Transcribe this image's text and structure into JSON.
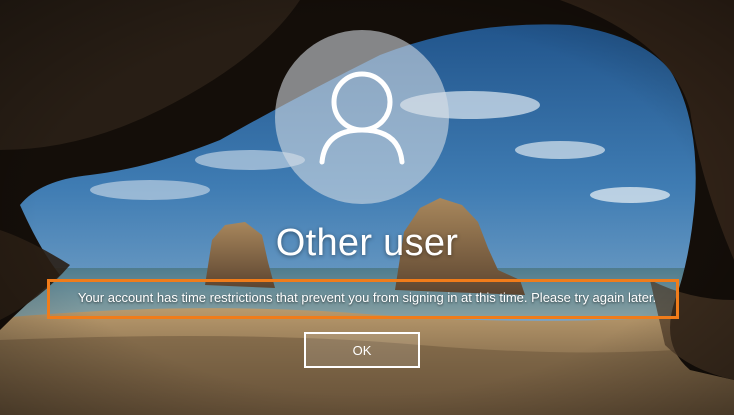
{
  "lock_screen": {
    "username": "Other user",
    "avatar_icon": "user-silhouette-icon",
    "error_message": "Your account has time restrictions that prevent you from signing in at this time. Please try again later.",
    "ok_button_label": "OK",
    "highlight_color": "#f07c1a"
  }
}
